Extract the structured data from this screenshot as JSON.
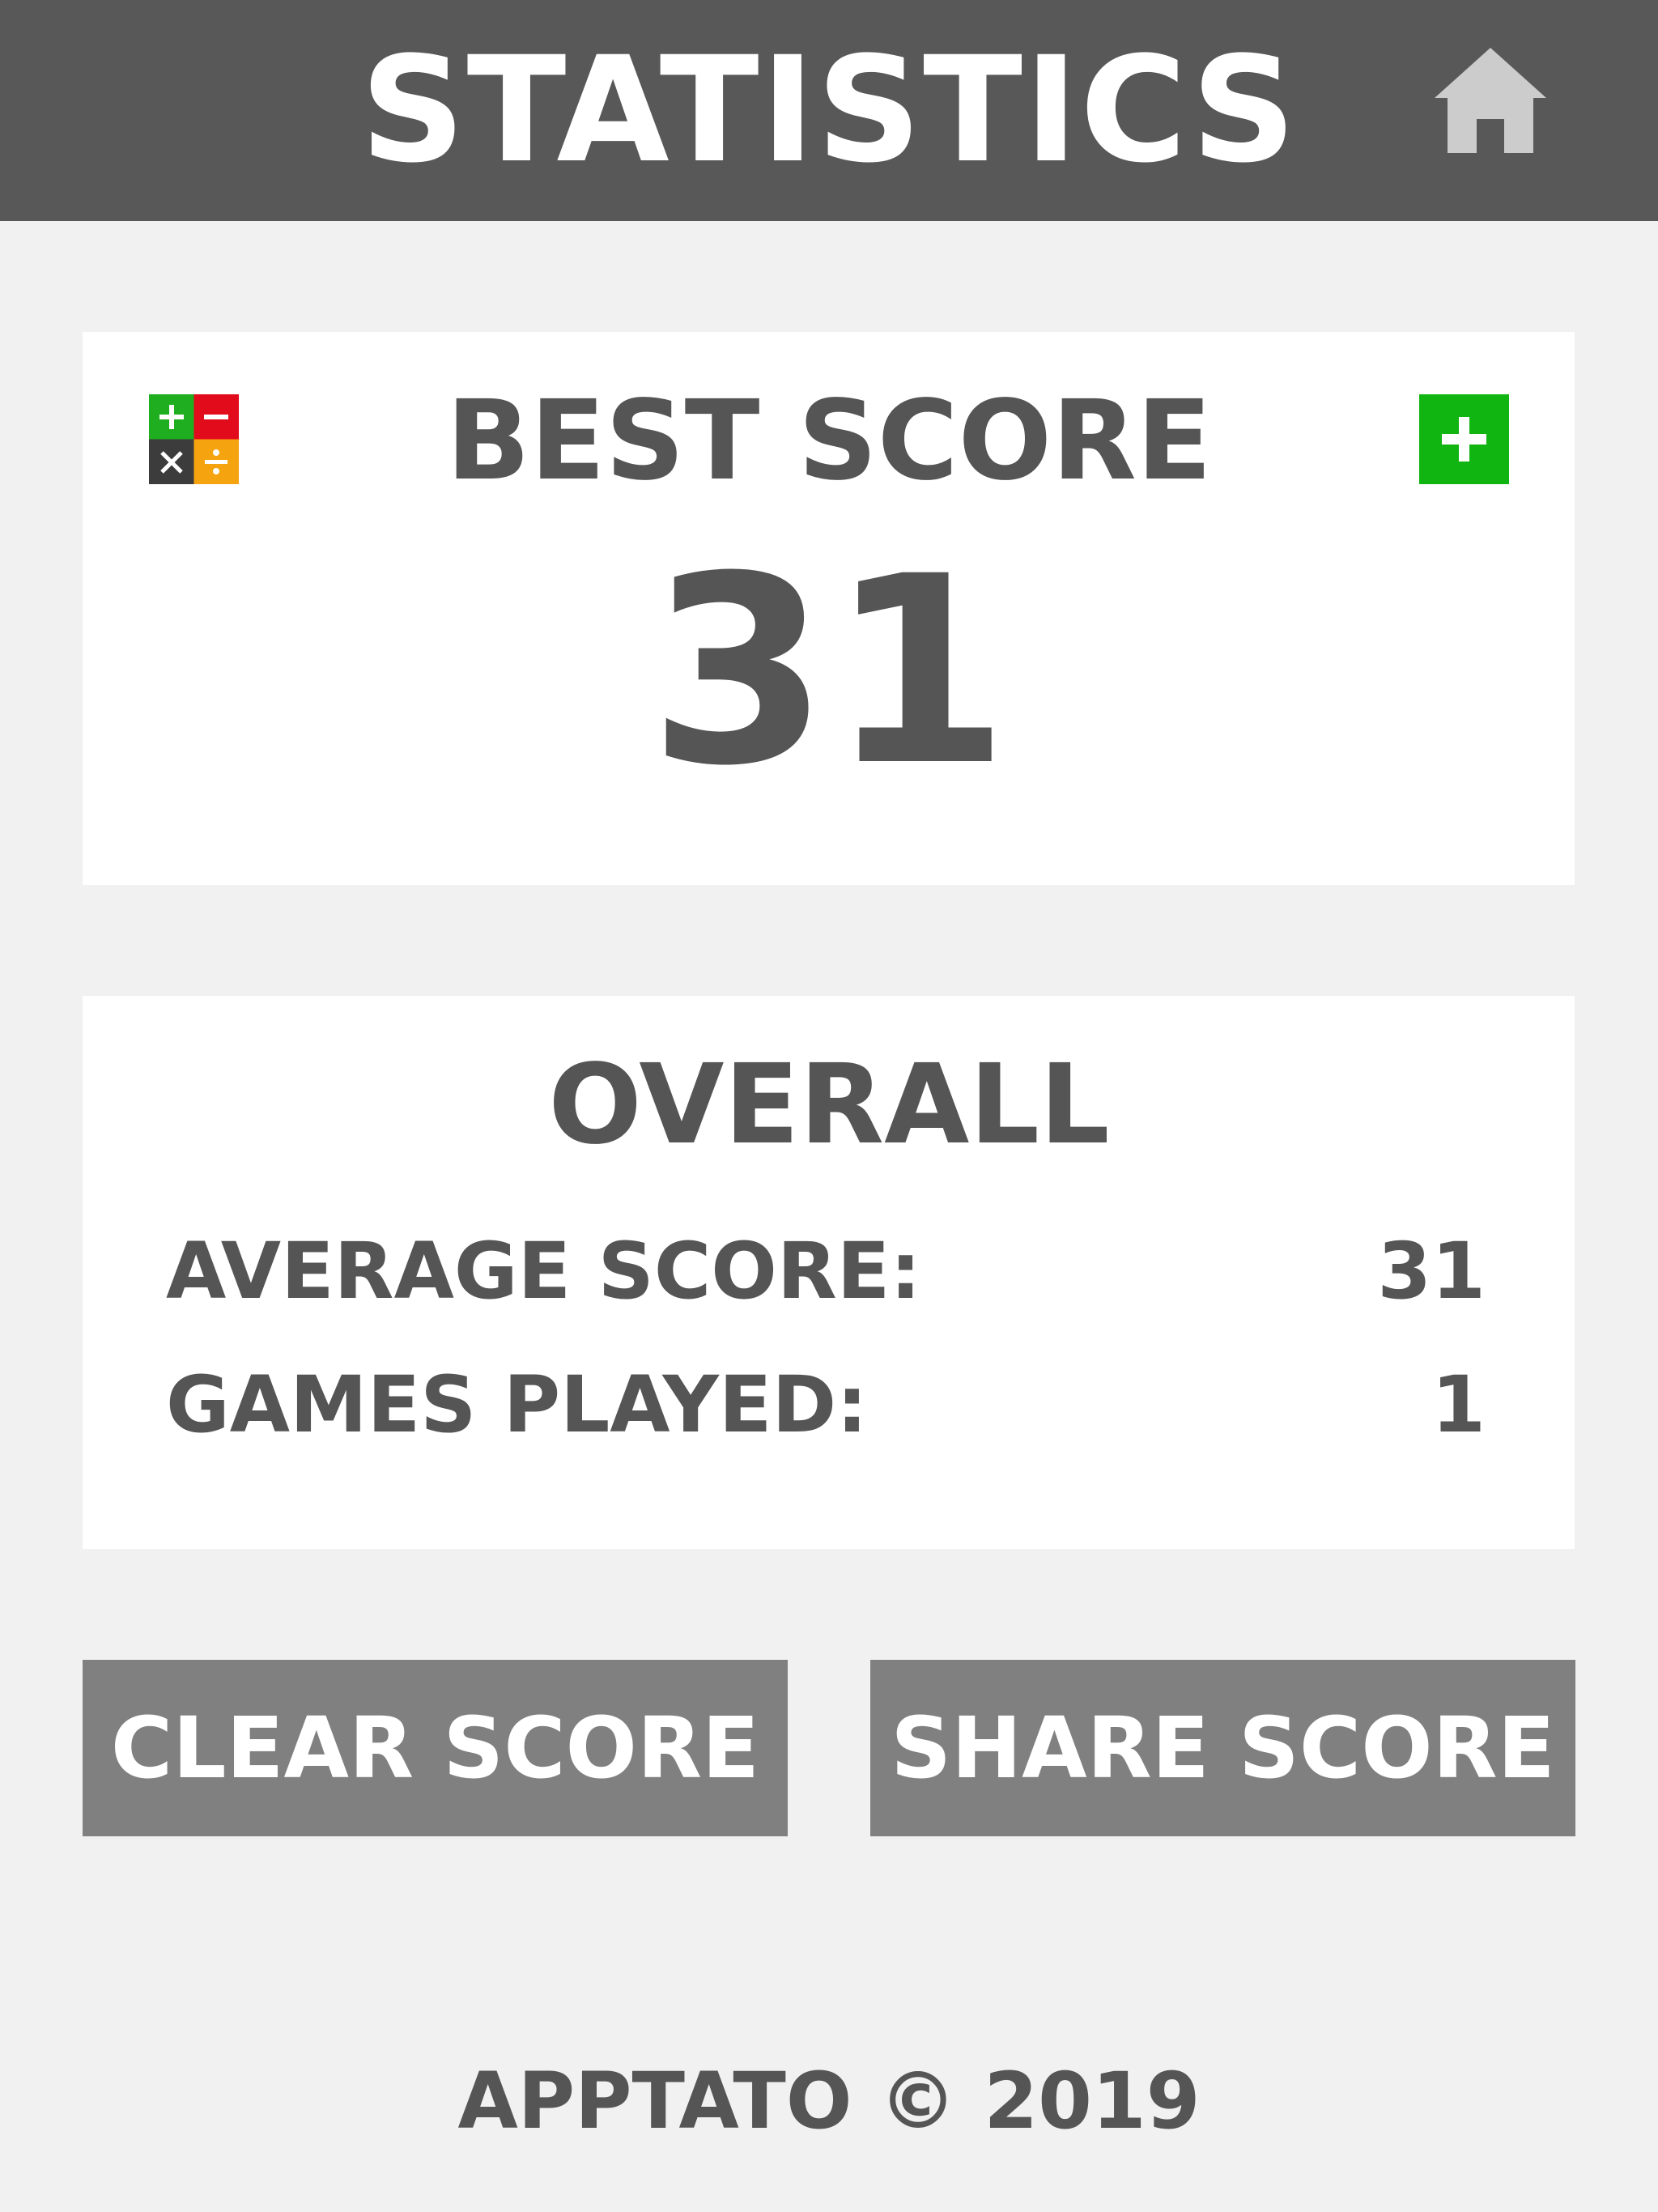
{
  "header": {
    "title": "STATISTICS",
    "home_icon": "home-icon"
  },
  "best_score": {
    "title": "BEST SCORE",
    "value": "31",
    "logo_icon": "math-operators-icon",
    "logo_colors": {
      "plus": "#1fae1f",
      "minus": "#e10b1b",
      "times": "#3c3c3c",
      "divide": "#f5a30f"
    },
    "plus_icon": "plus-icon",
    "plus_color": "#11b511"
  },
  "overall": {
    "title": "OVERALL",
    "stats": [
      {
        "label": "AVERAGE SCORE:",
        "value": "31"
      },
      {
        "label": "GAMES PLAYED:",
        "value": "1"
      }
    ]
  },
  "buttons": {
    "clear": "CLEAR SCORE",
    "share": "SHARE SCORE"
  },
  "footer": {
    "text": "APPTATO © 2019"
  },
  "colors": {
    "header_bg": "#585858",
    "page_bg": "#f1f1f1",
    "card_bg": "#ffffff",
    "text": "#555555",
    "button_bg": "#808080",
    "home_icon": "#cccccc"
  }
}
